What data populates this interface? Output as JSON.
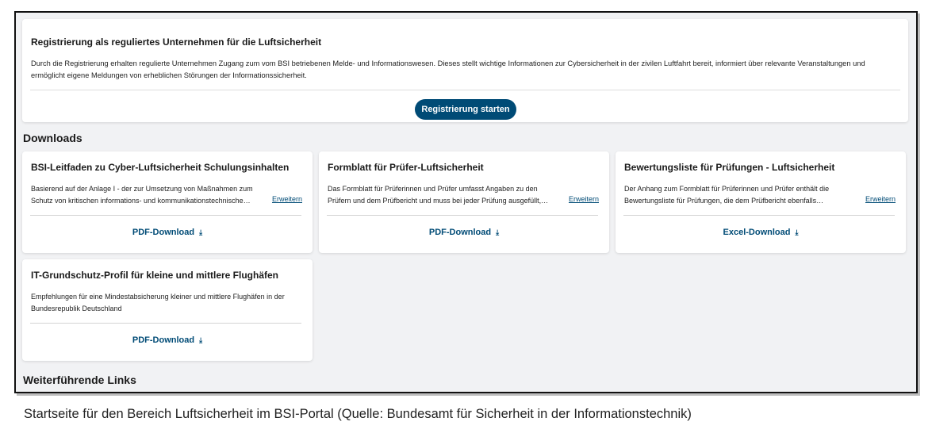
{
  "registration": {
    "title": "Registrierung als reguliertes Unternehmen für die Luftsicherheit",
    "description_line1": "Durch die Registrierung erhalten regulierte Unternehmen Zugang zum vom BSI betriebenen Melde- und Informationswesen. Dieses stellt wichtige Informationen zur Cybersicherheit in der zivilen Luftfahrt bereit, informiert über relevante Veranstaltungen und",
    "description_line2": "ermöglicht eigene Meldungen von erheblichen Störungen der Informationssicherheit.",
    "button_label": "Registrierung starten"
  },
  "downloads": {
    "heading": "Downloads",
    "items": [
      {
        "title": "BSI-Leitfaden zu Cyber-Luftsicherheit Schulungsinhalten",
        "desc_line1": "Basierend auf der Anlage I - der zur Umsetzung von Maßnahmen zum",
        "desc_line2": "Schutz von kritischen informations- und kommunikationstechnische…",
        "expand_label": "Erweitern",
        "link_label": "PDF-Download",
        "link_icon": "download-icon"
      },
      {
        "title": "Formblatt für Prüfer-Luftsicherheit",
        "desc_line1": "Das Formblatt für Prüferinnen und Prüfer umfasst Angaben zu den",
        "desc_line2": "Prüfern und dem Prüfbericht und muss bei jeder Prüfung ausgefüllt,…",
        "expand_label": "Erweitern",
        "link_label": "PDF-Download",
        "link_icon": "download-icon"
      },
      {
        "title": "Bewertungsliste für Prüfungen - Luftsicherheit",
        "desc_line1": "Der Anhang zum Formblatt für Prüferinnen und Prüfer enthält die",
        "desc_line2": "Bewertungsliste für Prüfungen, die dem Prüfbericht ebenfalls…",
        "expand_label": "Erweitern",
        "link_label": "Excel-Download",
        "link_icon": "download-icon"
      },
      {
        "title": "IT-Grundschutz-Profil für kleine und mittlere Flughäfen",
        "desc_line1": "Empfehlungen für eine Mindestabsicherung kleiner und mittlere Flughäfen in der",
        "desc_line2": "Bundesrepublik Deutschland",
        "link_label": "PDF-Download",
        "link_icon": "download-icon"
      }
    ]
  },
  "links_heading": "Weiterführende Links",
  "caption": "Startseite für den Bereich Luftsicherheit im BSI-Portal (Quelle: Bundesamt für Sicherheit in der Informationstechnik)",
  "colors": {
    "accent": "#004b76",
    "background": "#f1f2f4"
  }
}
